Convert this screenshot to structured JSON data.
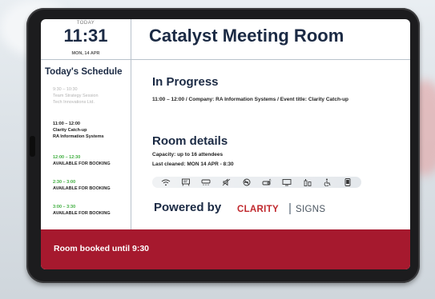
{
  "clock": {
    "today_label": "TODAY",
    "time": "11:31",
    "date": "MON, 14 APR"
  },
  "room": {
    "title": "Catalyst Meeting Room"
  },
  "schedule": {
    "title": "Today's Schedule",
    "entries": [
      {
        "time": "9:30 – 10:30",
        "line1": "Team Strategy Session",
        "line2": "Tech Innovations Ltd.",
        "status": "past"
      },
      {
        "time": "11:00 – 12:00",
        "line1": "Clarity Catch-up",
        "line2": "RA Information Systems",
        "status": "current"
      },
      {
        "time": "12:00 – 12:30",
        "line1": "AVAILABLE FOR BOOKING",
        "status": "available"
      },
      {
        "time": "2:30 – 3:00",
        "line1": "AVAILABLE FOR BOOKING",
        "status": "available"
      },
      {
        "time": "3:00 – 3:30",
        "line1": "AVAILABLE FOR BOOKING",
        "status": "available"
      }
    ]
  },
  "in_progress": {
    "title": "In Progress",
    "detail": "11:00 – 12:00 / Company: RA Information Systems / Event title: Clarity Catch-up"
  },
  "room_details": {
    "title": "Room details",
    "capacity": "Capacity: up to 16 attendees",
    "cleaned": "Last cleaned: MON 14 APR - 8:30",
    "amenities": [
      "wifi-icon",
      "whiteboard-icon",
      "air-conditioning-icon",
      "speaker-muted-icon",
      "no-smoking-icon",
      "projector-icon",
      "display-icon",
      "water-icon",
      "accessible-icon",
      "tablet-icon"
    ]
  },
  "branding": {
    "powered_by": "Powered by",
    "brand_primary": "CLARITY",
    "brand_secondary": "SIGNS",
    "brand_color": "#c0282d"
  },
  "footer": {
    "status": "Room booked until 9:30",
    "color": "#a6192e"
  }
}
